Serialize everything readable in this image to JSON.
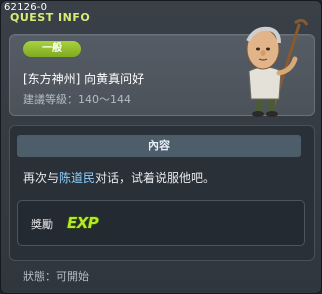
{
  "window": {
    "quest_id": "62126-0",
    "title": "QUEST INFO"
  },
  "info": {
    "level_badge": "一般",
    "quest_name": "[东方神州] 向黄真问好",
    "recommended_level": "建議等級：140～144"
  },
  "content": {
    "header": "內容",
    "desc_prefix": "再次与",
    "desc_npc": "陈道民",
    "desc_suffix": "对话，试着说服他吧。"
  },
  "reward": {
    "label": "獎勵",
    "exp_icon_text": "EXP"
  },
  "status": {
    "text": "狀態：可開始"
  },
  "colors": {
    "title": "#d9ec78",
    "badge": "#8ebd2c",
    "npc_name": "#8ed0ff",
    "exp": "#b6e82a"
  }
}
